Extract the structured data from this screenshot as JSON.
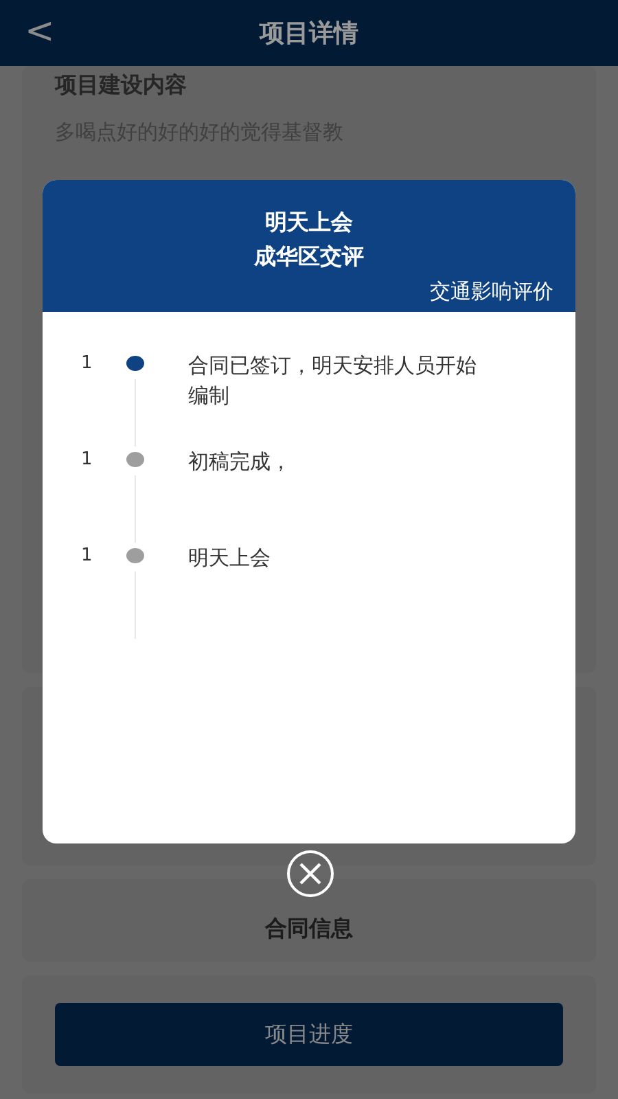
{
  "header": {
    "back": "<",
    "title": "项目详情"
  },
  "section": {
    "title": "项目建设内容",
    "text": "多喝点好的好的好的觉得基督教"
  },
  "contract": {
    "title": "合同信息"
  },
  "progress_button": "项目进度",
  "dialog": {
    "title_1": "明天上会",
    "title_2": "成华区交评",
    "subtitle": "交通影响评价",
    "timeline": [
      {
        "number": "1",
        "text": "合同已签订，明天安排人员开始编制",
        "active": true
      },
      {
        "number": "1",
        "text": "初稿完成，",
        "active": false
      },
      {
        "number": "1",
        "text": "明天上会",
        "active": false
      }
    ]
  }
}
